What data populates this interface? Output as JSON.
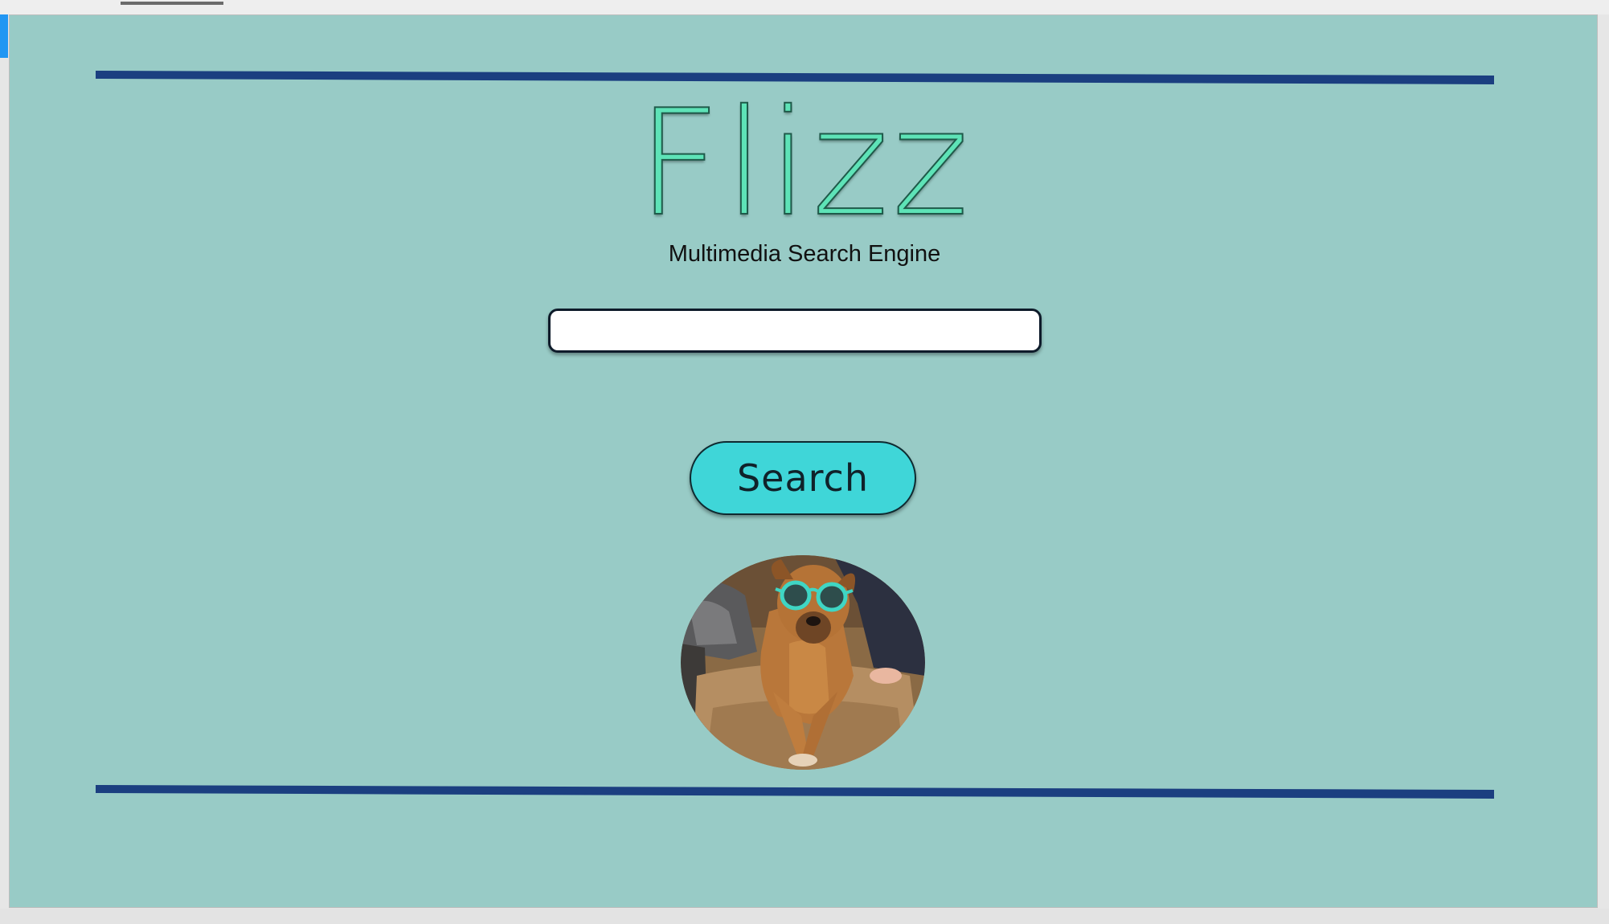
{
  "app": {
    "logo_text": "Flizz",
    "subtitle": "Multimedia Search Engine"
  },
  "search": {
    "value": "",
    "placeholder": "",
    "button_label": "Search"
  },
  "colors": {
    "background": "#98cbc6",
    "rule": "#1b3f80",
    "logo": "#5ee3b7",
    "button": "#3fd6d8"
  },
  "image": {
    "subject": "dog wearing turquoise sunglasses on a couch"
  }
}
